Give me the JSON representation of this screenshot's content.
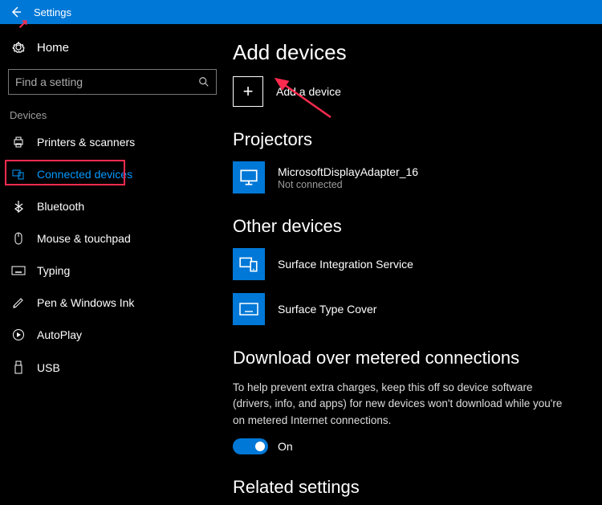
{
  "titlebar": {
    "title": "Settings"
  },
  "sidebar": {
    "home": "Home",
    "search_placeholder": "Find a setting",
    "section": "Devices",
    "items": [
      {
        "label": "Printers & scanners"
      },
      {
        "label": "Connected devices"
      },
      {
        "label": "Bluetooth"
      },
      {
        "label": "Mouse & touchpad"
      },
      {
        "label": "Typing"
      },
      {
        "label": "Pen & Windows Ink"
      },
      {
        "label": "AutoPlay"
      },
      {
        "label": "USB"
      }
    ]
  },
  "main": {
    "add_heading": "Add devices",
    "add_label": "Add a device",
    "projectors_heading": "Projectors",
    "projector": {
      "name": "MicrosoftDisplayAdapter_16",
      "status": "Not connected"
    },
    "other_heading": "Other devices",
    "devices": [
      {
        "name": "Surface Integration Service"
      },
      {
        "name": "Surface Type Cover"
      }
    ],
    "metered_heading": "Download over metered connections",
    "metered_desc": "To help prevent extra charges, keep this off so device software (drivers, info, and apps) for new devices won't download while you're on metered Internet connections.",
    "toggle_state": "On",
    "related_heading": "Related settings"
  }
}
